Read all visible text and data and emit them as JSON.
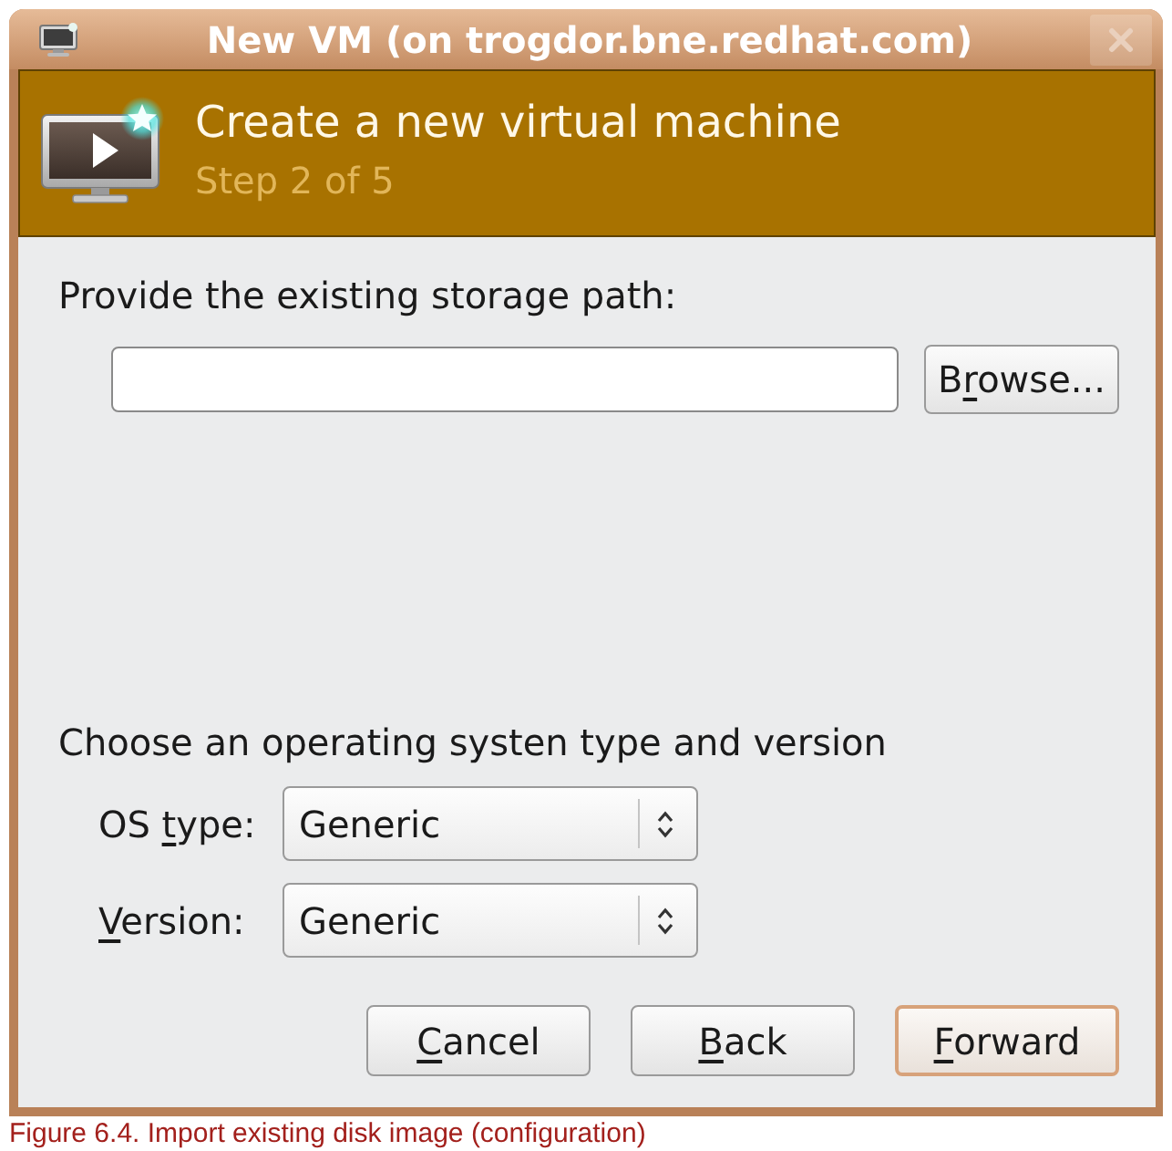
{
  "window": {
    "title": "New VM (on trogdor.bne.redhat.com)"
  },
  "header": {
    "title": "Create a new virtual machine",
    "subtitle": "Step 2 of 5"
  },
  "storage": {
    "label": "Provide the existing storage path:",
    "browse_button": {
      "label": {
        "before": "B",
        "key": "r",
        "after": "owse..."
      }
    }
  },
  "os": {
    "heading": "Choose an operating systen type and version",
    "fields": [
      {
        "label": {
          "before": "OS ",
          "key": "t",
          "after": "ype:"
        },
        "value": "Generic"
      },
      {
        "label": {
          "key": "V",
          "after": "ersion:"
        },
        "value": "Generic"
      }
    ]
  },
  "buttons": [
    {
      "label": {
        "key": "C",
        "after": "ancel"
      },
      "default": false
    },
    {
      "label": {
        "key": "B",
        "after": "ack"
      },
      "default": false
    },
    {
      "label": {
        "key": "F",
        "after": "orward"
      },
      "default": true
    }
  ],
  "caption": "Figure 6.4. Import existing disk image (configuration)"
}
